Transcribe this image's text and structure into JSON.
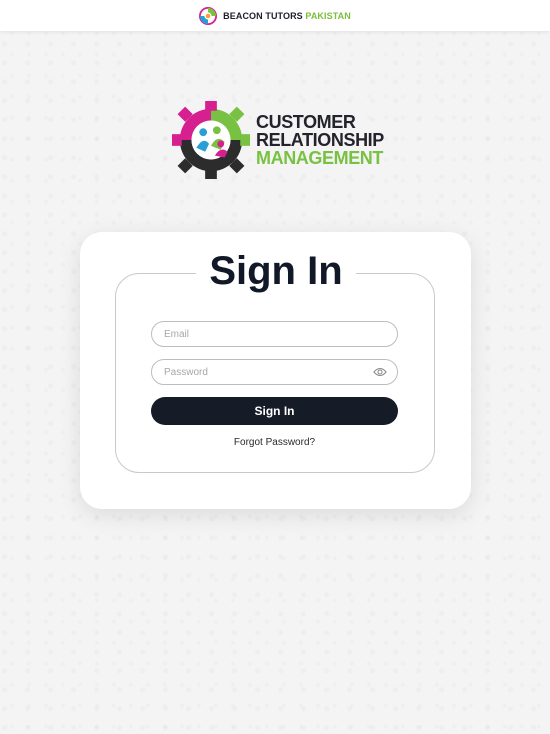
{
  "topbar": {
    "brand_main": "BEACON TUTORS",
    "brand_accent": "PAKISTAN",
    "logo_icon": "beacon-tutors-logo"
  },
  "crm_logo": {
    "line1": "CUSTOMER",
    "line2": "RELATIONSHIP",
    "line3": "MANAGEMENT",
    "icon": "gear-people-logo"
  },
  "signin": {
    "title": "Sign In",
    "email_placeholder": "Email",
    "email_value": "",
    "password_placeholder": "Password",
    "password_value": "",
    "password_toggle_icon": "eye-icon",
    "button_label": "Sign In",
    "forgot_label": "Forgot Password?"
  },
  "colors": {
    "accent_green": "#79c142",
    "accent_magenta": "#d6208f",
    "accent_teal": "#2a9fd6",
    "dark": "#151b27"
  }
}
